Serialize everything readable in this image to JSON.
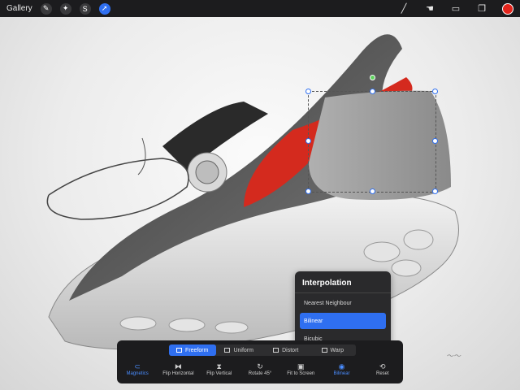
{
  "topbar": {
    "gallery_label": "Gallery",
    "left_tools": [
      {
        "icon": "wrench-icon",
        "glyph": "✎"
      },
      {
        "icon": "magic-wand-icon",
        "glyph": "✦"
      },
      {
        "icon": "selection-icon",
        "glyph": "S"
      },
      {
        "icon": "transform-arrow-icon",
        "glyph": "➚",
        "active": true
      }
    ],
    "right_tools": [
      {
        "icon": "brush-icon",
        "glyph": "╱"
      },
      {
        "icon": "smudge-icon",
        "glyph": "☚"
      },
      {
        "icon": "eraser-icon",
        "glyph": "▭"
      },
      {
        "icon": "layers-icon",
        "glyph": "❐"
      }
    ],
    "active_color": "#e3241b"
  },
  "interpolation": {
    "title": "Interpolation",
    "options": [
      "Nearest Neighbour",
      "Bilinear",
      "Bicubic"
    ],
    "selected": "Bilinear"
  },
  "transform": {
    "modes": [
      "Freeform",
      "Uniform",
      "Distort",
      "Warp"
    ],
    "selected_mode": "Freeform",
    "actions": [
      {
        "label": "Magnetics",
        "glyph": "⊂"
      },
      {
        "label": "Flip Horizontal",
        "glyph": "⧓"
      },
      {
        "label": "Flip Vertical",
        "glyph": "⧗"
      },
      {
        "label": "Rotate 45°",
        "glyph": "↻"
      },
      {
        "label": "Fit to Screen",
        "glyph": "▣"
      },
      {
        "label": "Bilinear",
        "glyph": "◉"
      },
      {
        "label": "Reset",
        "glyph": "⟲"
      }
    ]
  },
  "colors": {
    "accent": "#2f6ff0",
    "shoe_red": "#d42a1e",
    "toolbar_bg": "#1c1c1e"
  }
}
